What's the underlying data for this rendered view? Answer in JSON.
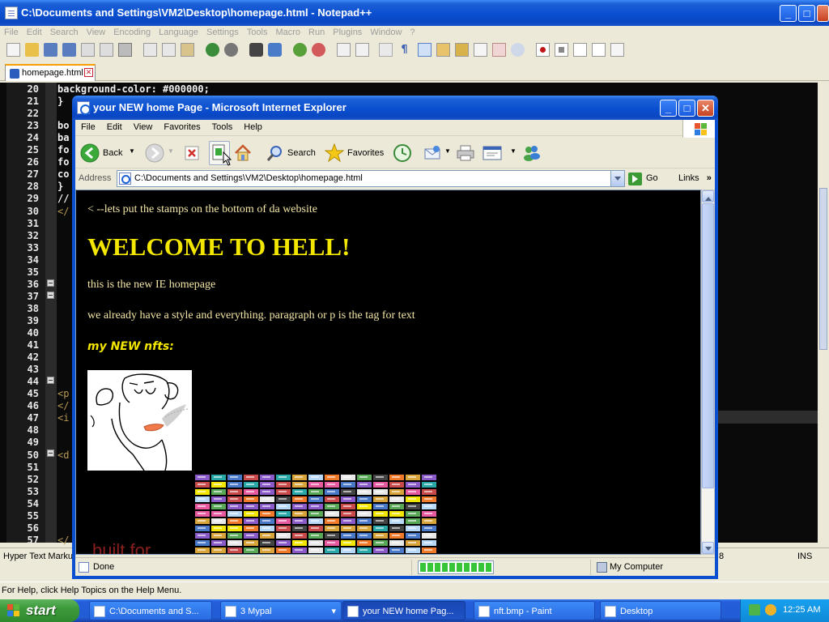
{
  "npp": {
    "title": "C:\\Documents and Settings\\VM2\\Desktop\\homepage.html - Notepad++",
    "menu": [
      "File",
      "Edit",
      "Search",
      "View",
      "Encoding",
      "Language",
      "Settings",
      "Tools",
      "Macro",
      "Run",
      "Plugins",
      "Window",
      "?"
    ],
    "tab_label": "homepage.html",
    "line_numbers": [
      "20",
      "21",
      "22",
      "23",
      "24",
      "25",
      "26",
      "27",
      "28",
      "29",
      "30",
      "31",
      "32",
      "33",
      "34",
      "35",
      "36",
      "37",
      "38",
      "39",
      "40",
      "41",
      "42",
      "43",
      "44",
      "45",
      "46",
      "47",
      "48",
      "49",
      "50",
      "51",
      "52",
      "53",
      "54",
      "55",
      "56",
      "57"
    ],
    "code_lines": [
      {
        "line": "20",
        "text": "background-color: #000000;"
      },
      {
        "line": "21",
        "text": "}"
      },
      {
        "line": "23",
        "text": "bo"
      },
      {
        "line": "24",
        "text": "ba"
      },
      {
        "line": "25",
        "text": "fo"
      },
      {
        "line": "26",
        "text": "fo"
      },
      {
        "line": "27",
        "text": "co"
      },
      {
        "line": "28",
        "text": "}"
      },
      {
        "line": "29",
        "text": "//"
      },
      {
        "line": "30",
        "text": "</"
      },
      {
        "line": "45",
        "text": "<p"
      },
      {
        "line": "46",
        "text": "</"
      },
      {
        "line": "47",
        "text": "<i"
      },
      {
        "line": "50",
        "text": "<d"
      },
      {
        "line": "57",
        "text": "</"
      }
    ],
    "status_left": "Hyper Text Marku",
    "status_num": "8",
    "status_ins": "INS",
    "help_text": "For Help, click Help Topics on the Help Menu."
  },
  "ie": {
    "title": "your NEW home Page - Microsoft Internet Explorer",
    "menu": [
      "File",
      "Edit",
      "View",
      "Favorites",
      "Tools",
      "Help"
    ],
    "toolbar": {
      "back": "Back",
      "search": "Search",
      "favorites": "Favorites"
    },
    "address_label": "Address",
    "address_value": "C:\\Documents and Settings\\VM2\\Desktop\\homepage.html",
    "go_label": "Go",
    "links_label": "Links",
    "page": {
      "comment": "< --lets put the stamps on the bottom of da website",
      "heading": "WELCOME TO HELL!",
      "p1": "this is the new IE homepage",
      "p2": "we already have a style and everything. paragraph or p is the tag for text",
      "subheading": "my NEW nfts:",
      "footer_partial": "built for"
    },
    "status_text": "Done",
    "progress": 1.0,
    "zone_text": "My Computer"
  },
  "taskbar": {
    "start_label": "start",
    "tasks": [
      {
        "label": "C:\\Documents and S...",
        "active": false
      },
      {
        "label": "3 Mypal",
        "active": false
      },
      {
        "label": "your NEW home Pag...",
        "active": true
      },
      {
        "label": "nft.bmp - Paint",
        "active": false
      },
      {
        "label": "Desktop",
        "active": false
      }
    ],
    "clock": "12:25 AM"
  },
  "colors": {
    "xp_blue": "#0a4fd0",
    "page_bg": "#000000",
    "heading_yellow": "#f3e600",
    "text_cream": "#f3e6a6"
  }
}
